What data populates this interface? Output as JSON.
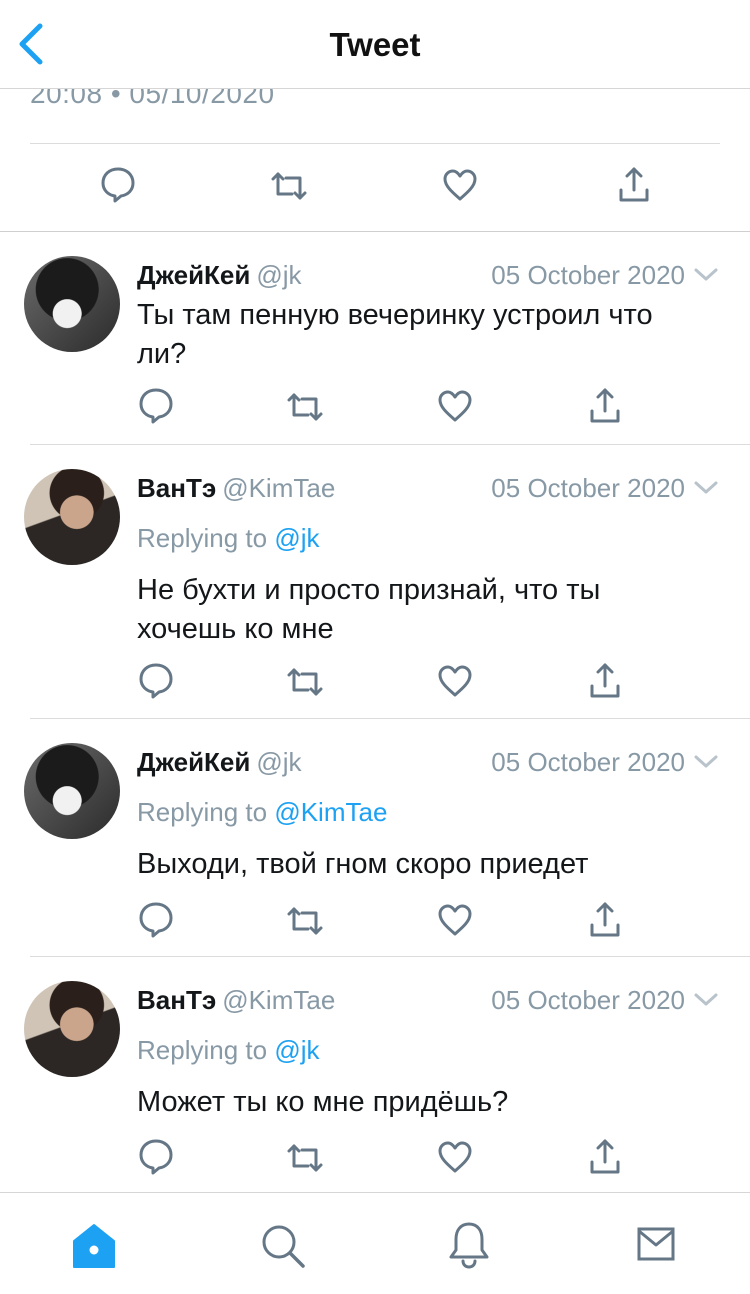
{
  "header": {
    "title": "Tweet"
  },
  "main_tweet": {
    "timestamp": "20:08 • 05/10/2020"
  },
  "colors": {
    "accent": "#1da1f2",
    "secondary_text": "#8899a6",
    "primary_text": "#14171a"
  },
  "replies": [
    {
      "name": "ДжейКей",
      "handle": "@jk",
      "date": "05 October 2020",
      "replying_label": "",
      "replying_to": "",
      "text": "Ты там пенную вечеринку устроил что ли?"
    },
    {
      "name": "ВанТэ",
      "handle": "@KimTae",
      "date": "05 October 2020",
      "replying_label": "Replying to",
      "replying_to": "@jk",
      "text": "Не бухти и просто признай, что ты хочешь ко мне"
    },
    {
      "name": "ДжейКей",
      "handle": "@jk",
      "date": "05 October 2020",
      "replying_label": "Replying to",
      "replying_to": "@KimTae",
      "text": "Выходи, твой гном скоро приедет"
    },
    {
      "name": "ВанТэ",
      "handle": "@KimTae",
      "date": "05 October 2020",
      "replying_label": "Replying to",
      "replying_to": "@jk",
      "text": "Может ты ко мне придёшь?"
    }
  ],
  "action_icons": [
    "reply-icon",
    "retweet-icon",
    "like-icon",
    "share-icon"
  ],
  "tab_bar": {
    "icons": [
      "home-icon",
      "search-icon",
      "notifications-icon",
      "messages-icon"
    ],
    "active": "home-icon"
  }
}
